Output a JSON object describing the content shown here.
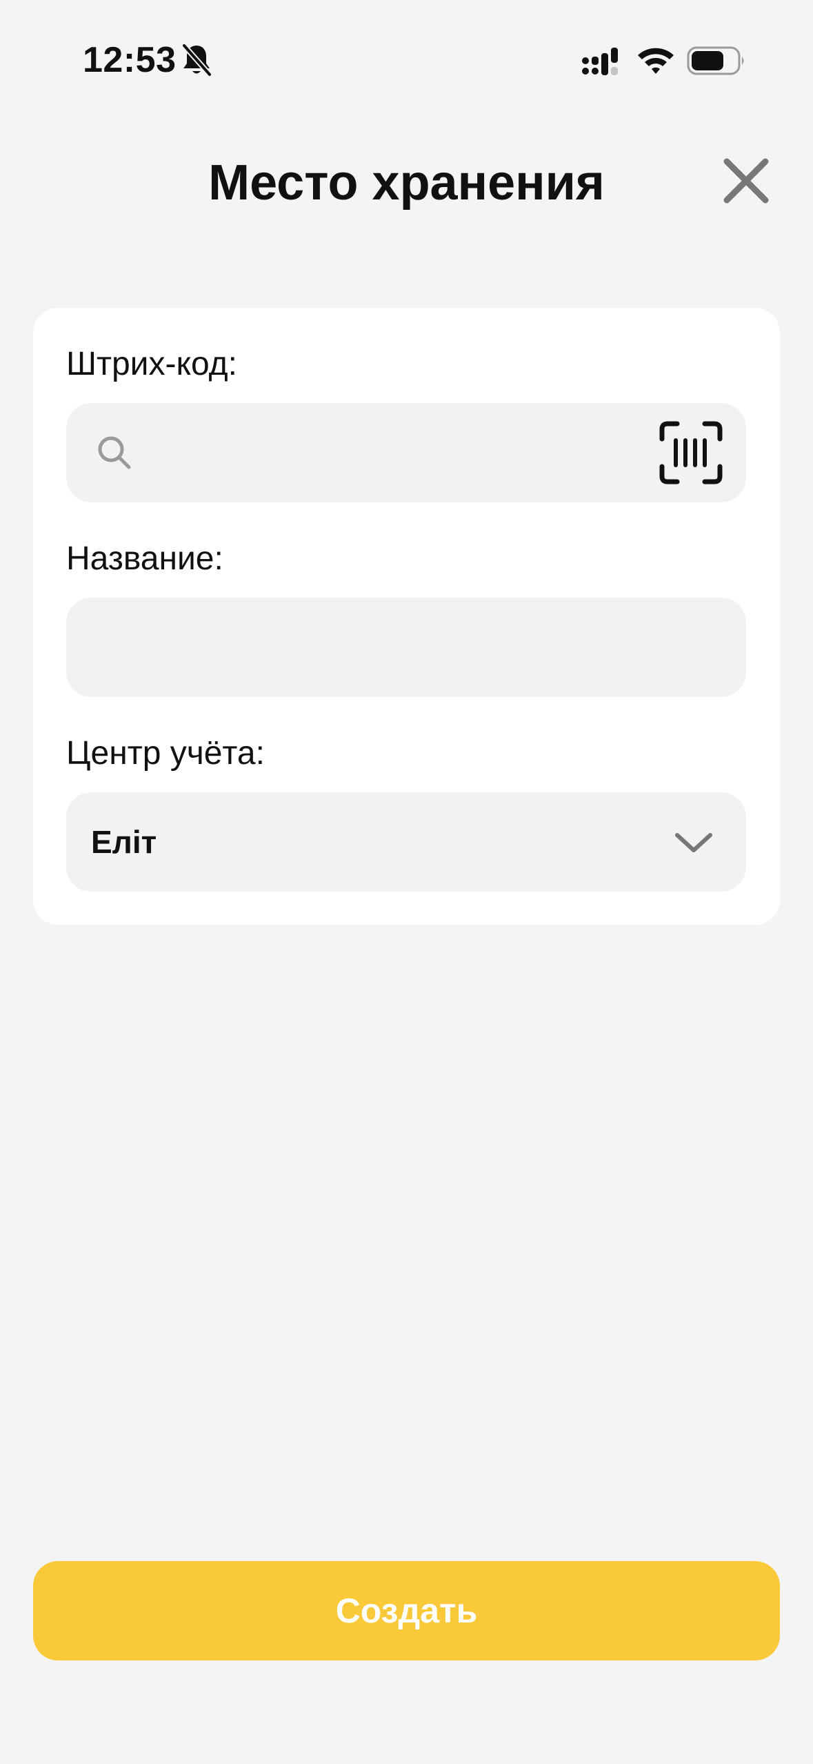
{
  "status_bar": {
    "time": "12:53",
    "icons": [
      "bell-slash-icon",
      "cellular-signal-icon",
      "wifi-icon",
      "battery-icon"
    ]
  },
  "header": {
    "title": "Место хранения",
    "close_icon": "close-icon"
  },
  "form": {
    "barcode": {
      "label": "Штрих-код:",
      "value": "",
      "placeholder": "",
      "left_icon": "search-icon",
      "right_icon": "barcode-scan-icon"
    },
    "name": {
      "label": "Название:",
      "value": "",
      "placeholder": ""
    },
    "accounting_center": {
      "label": "Центр учёта:",
      "selected": "Еліт",
      "icon": "chevron-down-icon"
    }
  },
  "actions": {
    "create_label": "Создать"
  },
  "colors": {
    "background": "#f4f4f5",
    "card": "#ffffff",
    "field": "#f1f2f4",
    "accent": "#f9c93a",
    "icon_gray": "#777777",
    "text": "#111111"
  }
}
